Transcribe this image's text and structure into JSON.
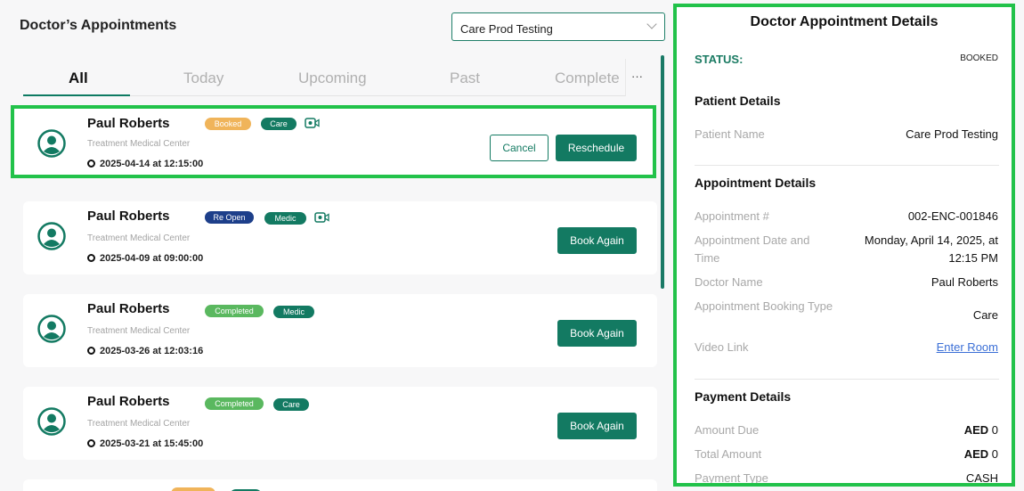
{
  "header": {
    "title": "Doctor’s Appointments",
    "patient_select_value": "Care Prod Testing"
  },
  "tabs": [
    {
      "label": "All",
      "active": true
    },
    {
      "label": "Today",
      "active": false
    },
    {
      "label": "Upcoming",
      "active": false
    },
    {
      "label": "Past",
      "active": false
    },
    {
      "label": "Complete",
      "active": false
    }
  ],
  "tabs_more_label": "···",
  "appointments": [
    {
      "doctor": "Paul Roberts",
      "status": "Booked",
      "type": "Care",
      "video": true,
      "center": "Treatment Medical Center",
      "datetime": "2025-04-14 at 12:15:00",
      "actions": [
        "Cancel",
        "Reschedule"
      ],
      "selected": true
    },
    {
      "doctor": "Paul Roberts",
      "status": "Re Open",
      "type": "Medic",
      "video": true,
      "center": "Treatment Medical Center",
      "datetime": "2025-04-09 at 09:00:00",
      "actions": [
        "Book Again"
      ]
    },
    {
      "doctor": "Paul Roberts",
      "status": "Completed",
      "type": "Medic",
      "video": false,
      "center": "Treatment Medical Center",
      "datetime": "2025-03-26 at 12:03:16",
      "actions": [
        "Book Again"
      ]
    },
    {
      "doctor": "Paul Roberts",
      "status": "Completed",
      "type": "Care",
      "video": false,
      "center": "Treatment Medical Center",
      "datetime": "2025-03-21 at 15:45:00",
      "actions": [
        "Book Again"
      ]
    }
  ],
  "details": {
    "title": "Doctor Appointment Details",
    "status_label": "STATUS:",
    "status_value": "BOOKED",
    "patient_section": "Patient Details",
    "patient_name_label": "Patient Name",
    "patient_name": "Care Prod Testing",
    "appointment_section": "Appointment Details",
    "appointment_no_label": "Appointment #",
    "appointment_no": "002-ENC-001846",
    "datetime_label": "Appointment Date and Time",
    "datetime_value": "Monday, April 14, 2025, at 12:15 PM",
    "doctor_label": "Doctor Name",
    "doctor_value": "Paul Roberts",
    "booking_type_label": "Appointment Booking Type",
    "booking_type_value": "Care",
    "video_label": "Video Link",
    "video_value": "Enter Room",
    "payment_section": "Payment Details",
    "amount_due_label": "Amount Due",
    "amount_due_currency": "AED",
    "amount_due_value": "0",
    "total_label": "Total Amount",
    "total_currency": "AED",
    "total_value": "0",
    "payment_type_label": "Payment Type",
    "payment_type_value": "CASH"
  },
  "colors": {
    "accent": "#137a62",
    "selection": "#22c24a",
    "booked": "#f0b45a",
    "reopen": "#1d3f8a",
    "completed": "#5ab85f"
  }
}
